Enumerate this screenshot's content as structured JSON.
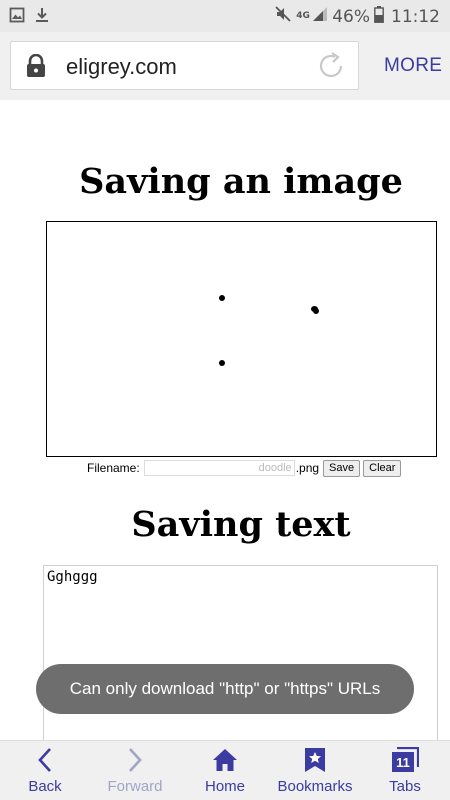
{
  "status_bar": {
    "network_label": "4G",
    "battery": "46%",
    "time": "11:12",
    "icons": [
      "image-notification-icon",
      "download-icon",
      "mute-icon",
      "signal-icon",
      "battery-icon"
    ]
  },
  "address_bar": {
    "url": "eligrey.com",
    "more_label": "MORE"
  },
  "page": {
    "image_heading": "Saving an image",
    "filename_label": "Filename:",
    "filename_placeholder": "doodle",
    "filename_extension": ".png",
    "save_label": "Save",
    "clear_label": "Clear",
    "text_heading": "Saving text",
    "textarea_value": "Gghggg"
  },
  "toast": {
    "message": "Can only download \"http\" or \"https\" URLs"
  },
  "bottom_nav": {
    "back_label": "Back",
    "forward_label": "Forward",
    "home_label": "Home",
    "bookmarks_label": "Bookmarks",
    "tabs_label": "Tabs",
    "tabs_count": "11"
  },
  "colors": {
    "accent": "#3c3ba2",
    "accent_disabled": "#a3a3c8",
    "toast_bg": "#6e6e6e",
    "chrome_bg": "#f0f0f0"
  }
}
